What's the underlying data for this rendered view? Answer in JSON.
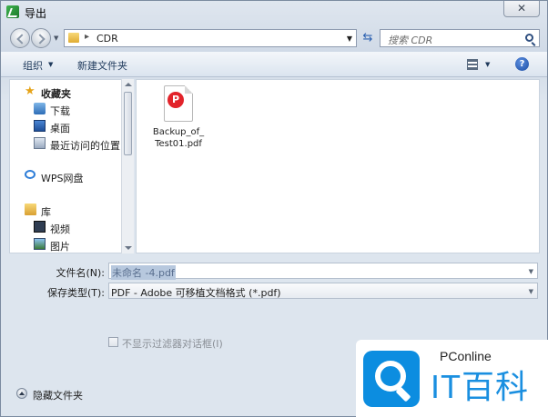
{
  "window": {
    "title": "导出",
    "close_label": "✕",
    "colors": {
      "accent": "#1e395b",
      "frame": "#cfd9e6",
      "watermark_blue": "#0c8de0"
    }
  },
  "address": {
    "path": "CDR",
    "separator": "▸",
    "search_placeholder": "搜索 CDR"
  },
  "toolbar": {
    "organize": "组织",
    "new_folder": "新建文件夹",
    "help": "?"
  },
  "nav": {
    "favorites": {
      "label": "收藏夹",
      "icon": "star-icon"
    },
    "favorites_items": [
      {
        "label": "下载",
        "icon": "download-icon"
      },
      {
        "label": "桌面",
        "icon": "desktop-icon"
      },
      {
        "label": "最近访问的位置",
        "icon": "recent-places-icon"
      }
    ],
    "wps": {
      "label": "WPS网盘",
      "icon": "cloud-icon"
    },
    "library": {
      "label": "库",
      "icon": "library-icon"
    },
    "library_items": [
      {
        "label": "视频",
        "icon": "video-icon"
      },
      {
        "label": "图片",
        "icon": "picture-icon"
      }
    ]
  },
  "files": [
    {
      "name_line1": "Backup_of_",
      "name_line2": "Test01.pdf",
      "badge": "P",
      "icon": "pdf-file-icon"
    }
  ],
  "form": {
    "filename_label": "文件名(N):",
    "filename_value": "未命名 -4.pdf",
    "filetype_label": "保存类型(T):",
    "filetype_value": "PDF - Adobe 可移植文档格式 (*.pdf)",
    "filter_checkbox_label": "不显示过滤器对话框(I)",
    "filter_checked": false
  },
  "footer": {
    "hide_folders": "隐藏文件夹"
  },
  "watermark": {
    "brand": "PConline",
    "name": "IT百科"
  }
}
